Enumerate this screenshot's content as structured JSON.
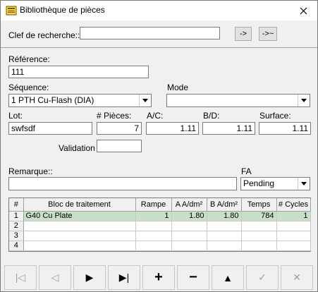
{
  "window": {
    "title": "Bibliothèque de pièces"
  },
  "search": {
    "label": "Clef de recherche::",
    "value": "",
    "btn_find": "->",
    "btn_find_next": "->~"
  },
  "reference": {
    "label": "Référence:",
    "value": "111"
  },
  "sequence": {
    "label": "Séquence:",
    "value": "1 PTH Cu-Flash (DIA)"
  },
  "mode": {
    "label": "Mode",
    "value": ""
  },
  "lot": {
    "label": "Lot:",
    "value": "swfsdf"
  },
  "pieces": {
    "label": "# Pièces:",
    "value": "7"
  },
  "ac": {
    "label": "A/C:",
    "value": "1.11"
  },
  "bd": {
    "label": "B/D:",
    "value": "1.11"
  },
  "surface": {
    "label": "Surface:",
    "value": "1.11"
  },
  "validation": {
    "label": "Validation",
    "value": ""
  },
  "remarque": {
    "label": "Remarque::",
    "value": ""
  },
  "fa": {
    "label": "FA",
    "value": "Pending"
  },
  "grid": {
    "headers": [
      "#",
      "Bloc de traitement",
      "Rampe",
      "A A/dm²",
      "B A/dm²",
      "Temps",
      "# Cycles"
    ],
    "rows": [
      [
        "1",
        "G40 Cu Plate",
        "1",
        "1.80",
        "1.80",
        "784",
        "1"
      ],
      [
        "2",
        "",
        "",
        "",
        "",
        "",
        ""
      ],
      [
        "3",
        "",
        "",
        "",
        "",
        "",
        ""
      ],
      [
        "4",
        "",
        "",
        "",
        "",
        "",
        ""
      ]
    ]
  },
  "nav": {
    "first": "|◁",
    "prev": "◁",
    "next": "▶",
    "last": "▶|",
    "add": "+",
    "remove": "−",
    "up": "▲",
    "confirm": "✓",
    "cancel": "✕"
  }
}
